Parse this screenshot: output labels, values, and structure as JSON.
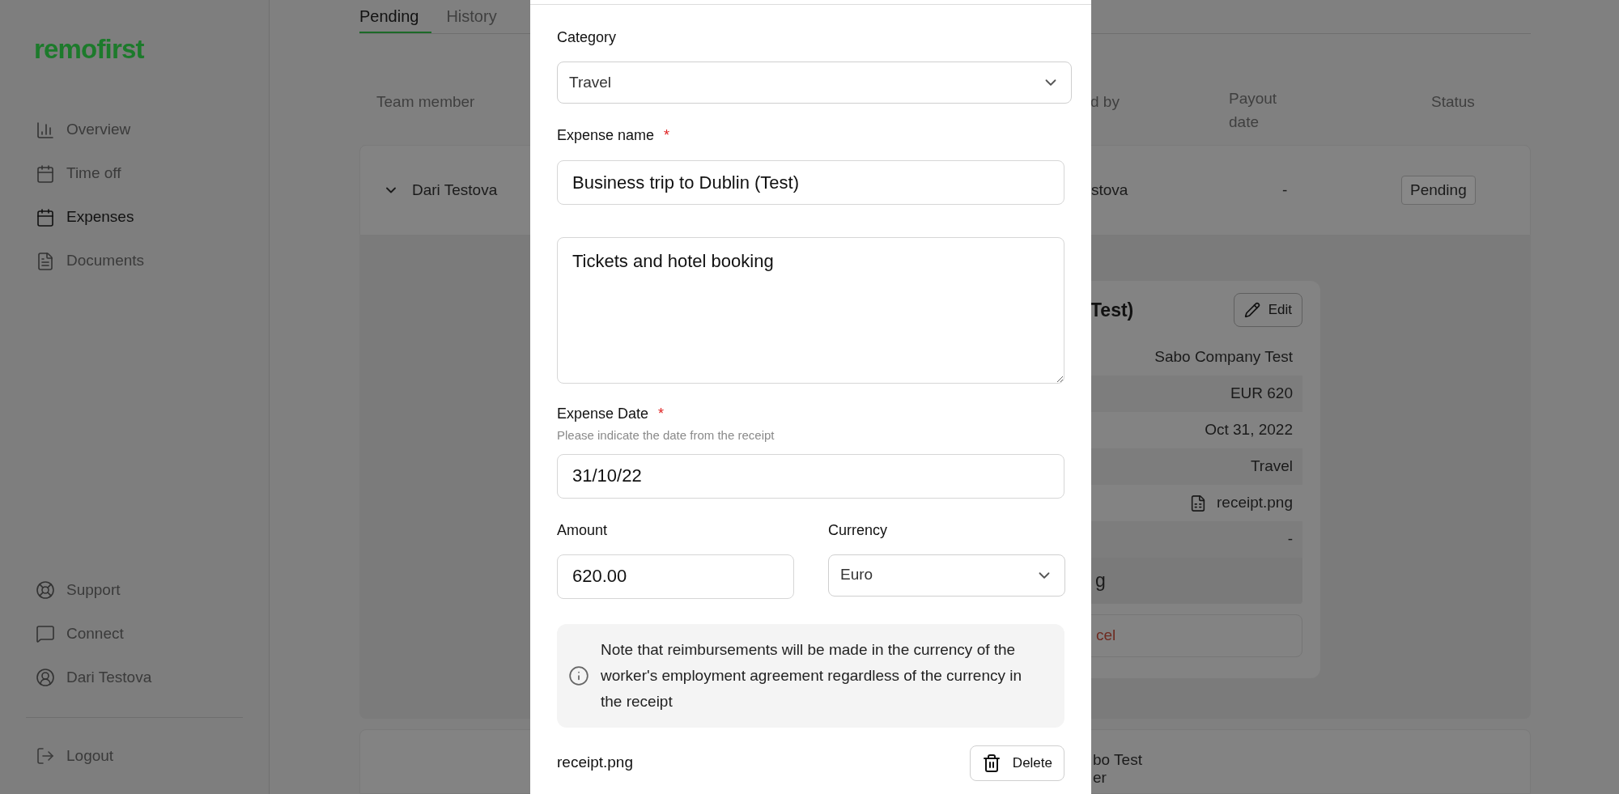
{
  "sidebar": {
    "logo": "remofirst",
    "nav": [
      {
        "label": "Overview",
        "selected": false
      },
      {
        "label": "Time off",
        "selected": false
      },
      {
        "label": "Expenses",
        "selected": true
      },
      {
        "label": "Documents",
        "selected": false
      }
    ],
    "bottom": [
      {
        "label": "Support"
      },
      {
        "label": "Connect"
      },
      {
        "label": "Dari Testova"
      }
    ],
    "logout": "Logout"
  },
  "tabs": [
    {
      "label": "Pending",
      "selected": true
    },
    {
      "label": "History",
      "selected": false
    }
  ],
  "table": {
    "columns": [
      "Team member",
      "d by",
      "Payout date",
      "Status"
    ],
    "rows": [
      {
        "member": "Dari Testova",
        "column_2": "stova",
        "payout_date": "-",
        "status": "Pending",
        "expanded": true
      }
    ]
  },
  "detail": {
    "title": "Test)",
    "edit": "Edit",
    "values": [
      {
        "kind": "text",
        "value": "Sabo Company Test"
      },
      {
        "kind": "text",
        "value": "EUR 620"
      },
      {
        "kind": "text",
        "value": "Oct 31, 2022"
      },
      {
        "kind": "text",
        "value": "Travel"
      },
      {
        "kind": "file",
        "value": "receipt.png"
      },
      {
        "kind": "text",
        "value": "-"
      }
    ],
    "comment": "g",
    "cancel": "cel"
  },
  "next_row": {
    "lines": [
      "bo Test",
      "er"
    ]
  },
  "modal": {
    "category": {
      "label": "Category",
      "value": "Travel"
    },
    "expense_name": {
      "label": "Expense name",
      "required_mark": "*",
      "value": "Business trip to Dublin (Test)"
    },
    "description": {
      "value": "Tickets and hotel booking"
    },
    "expense_date": {
      "label": "Expense Date",
      "required_mark": "*",
      "hint": "Please indicate the date from the receipt",
      "value": "31/10/22"
    },
    "amount": {
      "label": "Amount",
      "value": "620.00"
    },
    "currency": {
      "label": "Currency",
      "value": "Euro"
    },
    "note": "Note that reimbursements will be made in the currency of the worker's employment agreement regardless of the currency in the receipt",
    "attachment": {
      "name": "receipt.png",
      "delete": "Delete"
    }
  }
}
